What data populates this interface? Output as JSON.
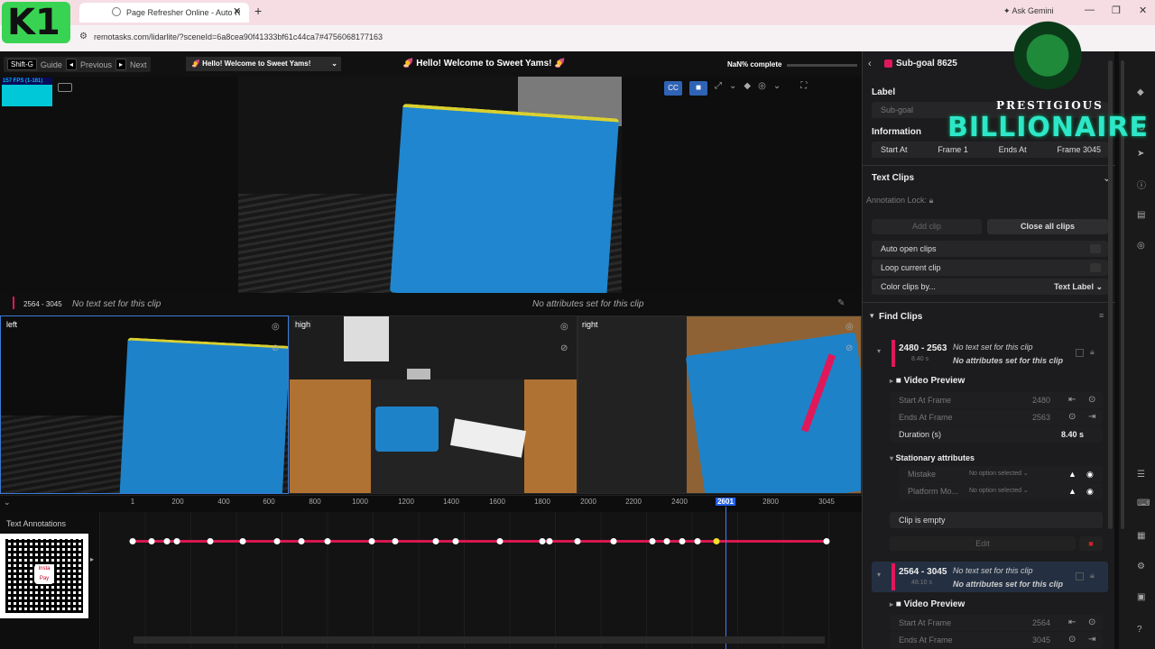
{
  "browser": {
    "tab_title": "Page Refresher Online - Auto R",
    "url": "remotasks.com/lidarlite/?sceneId=6a8cea90f41333bf61c44ca7#4756068177163",
    "ask_gemini": "Ask Gemini"
  },
  "overlay": {
    "logo_text": "K1",
    "billionaire_top": "PRESTIGIOUS",
    "billionaire_bottom": "BILLIONAIRE"
  },
  "topbar": {
    "shift_g": "Shift-G",
    "guide": "Guide",
    "previous": "Previous",
    "next": "Next",
    "welcome_dropdown": "🍠 Hello! Welcome to Sweet Yams!",
    "center_title": "🍠 Hello! Welcome to Sweet Yams! 🍠",
    "complete": "NaN% complete",
    "fps": "157 FPS (1-181)"
  },
  "clipbar": {
    "range": "2564 - 3045",
    "no_text": "No text set for this clip",
    "no_attrs": "No attributes set for this clip"
  },
  "cameras": {
    "left": "left",
    "high": "high",
    "right": "right"
  },
  "timeline": {
    "ticks": [
      "1",
      "200",
      "400",
      "600",
      "800",
      "1000",
      "1200",
      "1400",
      "1600",
      "1800",
      "2000",
      "2200",
      "2400",
      "2601",
      "2800",
      "3045"
    ],
    "current": "2601",
    "label": "Text Annotations"
  },
  "sidebar": {
    "header": "Sub-goal 8625",
    "label_title": "Label",
    "label_value": "Sub-goal",
    "information": "Information",
    "start_at": "Start At",
    "start_frame": "Frame 1",
    "ends_at": "Ends At",
    "end_frame": "Frame 3045",
    "text_clips": "Text Clips",
    "annotation_lock": "Annotation Lock:",
    "add_clip": "Add clip",
    "close_all": "Close all clips",
    "auto_open": "Auto open clips",
    "loop_current": "Loop current clip",
    "color_by": "Color clips by...",
    "color_by_value": "Text Label",
    "find_clips": "Find Clips",
    "clip1": {
      "range": "2480 - 2563",
      "duration_small": "8.40 s",
      "no_text": "No text set for this clip",
      "no_attrs": "No attributes set for this clip",
      "video_preview": "Video Preview",
      "start_label": "Start At Frame",
      "start_val": "2480",
      "end_label": "Ends At Frame",
      "end_val": "2563",
      "duration_label": "Duration (s)",
      "duration_val": "8.40 s",
      "stationary": "Stationary attributes",
      "mistake": "Mistake",
      "platform": "Platform Mo...",
      "no_option": "No option selected",
      "empty": "Clip is empty",
      "edit": "Edit"
    },
    "clip2": {
      "range": "2564 - 3045",
      "duration_small": "48.10 s",
      "no_text": "No text set for this clip",
      "no_attrs": "No attributes set for this clip",
      "video_preview": "Video Preview",
      "start_label": "Start At Frame",
      "start_val": "2564",
      "end_label": "Ends At Frame",
      "end_val": "3045"
    }
  }
}
